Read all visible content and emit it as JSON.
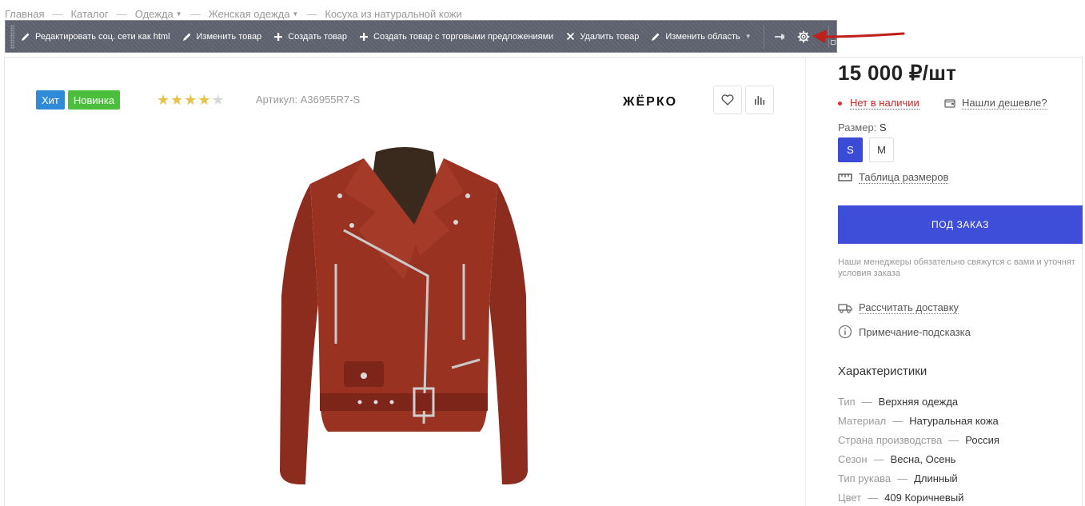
{
  "breadcrumb": {
    "items": [
      {
        "label": "Главная"
      },
      {
        "label": "Каталог"
      },
      {
        "label": "Одежда"
      },
      {
        "label": "Женская одежда"
      },
      {
        "label": "Косуха из натуральной кожи"
      }
    ]
  },
  "admin_toolbar": {
    "edit_social": "Редактировать соц. сети как html",
    "edit_product": "Изменить товар",
    "create_product": "Создать товар",
    "create_with_offers": "Создать товар с торговыми предложениями",
    "delete_product": "Удалить товар",
    "edit_area": "Изменить область"
  },
  "product": {
    "badges": {
      "hit": "Хит",
      "new": "Новинка"
    },
    "rating": 4,
    "rating_max": 5,
    "article_label": "Артикул:",
    "article_value": "A36955R7-S",
    "brand": "ЖЁРКО",
    "price": "15 000 ₽/шт",
    "stock": "Нет в наличии",
    "cheaper": "Нашли дешевле?",
    "size_label": "Размер:",
    "size_selected": "S",
    "sizes": [
      "S",
      "M"
    ],
    "size_table": "Таблица размеров",
    "order_button": "ПОД ЗАКАЗ",
    "manager_note": "Наши менеджеры обязательно свяжутся с вами и уточнят условия заказа",
    "delivery": "Рассчитать доставку",
    "hint": "Примечание-подсказка"
  },
  "characteristics": {
    "title": "Характеристики",
    "rows": [
      {
        "key": "Тип",
        "value": "Верхняя одежда"
      },
      {
        "key": "Материал",
        "value": "Натуральная кожа"
      },
      {
        "key": "Страна производства",
        "value": "Россия"
      },
      {
        "key": "Сезон",
        "value": "Весна, Осень"
      },
      {
        "key": "Тип рукава",
        "value": "Длинный"
      },
      {
        "key": "Цвет",
        "value": "409 Коричневый"
      }
    ]
  },
  "colors": {
    "accent": "#3e4ed8",
    "out_of_stock": "#c62828",
    "badge_hit": "#2f8ad8",
    "badge_new": "#4bbf3c",
    "toolbar_bg": "#5f6270",
    "jacket": "#8b2c1f"
  },
  "icons": [
    "pencil-icon",
    "plus-icon",
    "close-icon",
    "pin-icon",
    "gear-icon",
    "heart-icon",
    "compare-icon",
    "wallet-icon",
    "ruler-icon",
    "truck-icon",
    "info-icon"
  ]
}
